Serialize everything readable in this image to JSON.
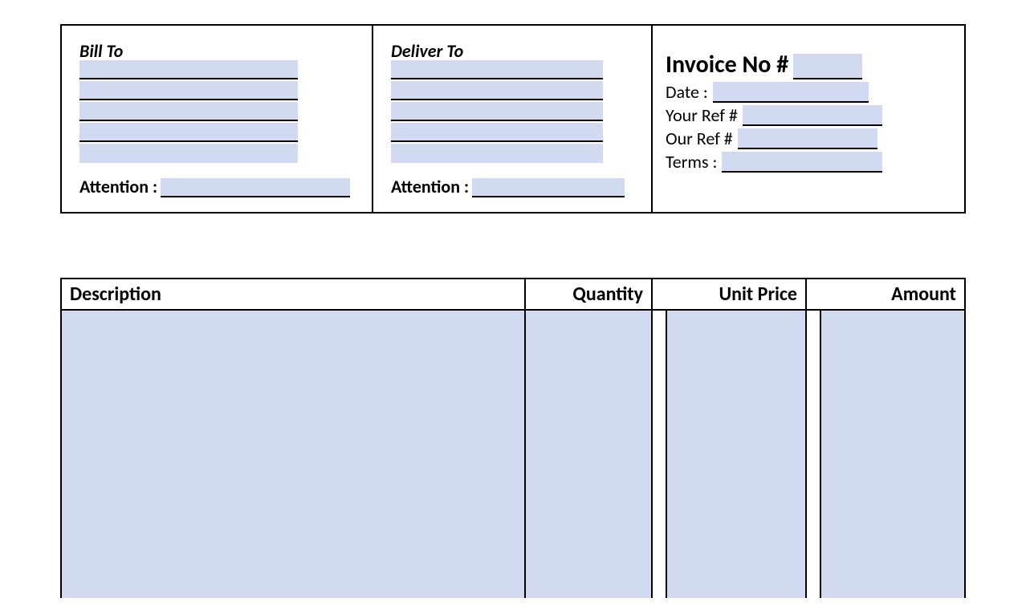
{
  "header": {
    "bill_to": {
      "title": "Bill To",
      "attention_label": "Attention :"
    },
    "deliver_to": {
      "title": "Deliver To",
      "attention_label": "Attention :"
    },
    "invoice": {
      "invoice_no_label": "Invoice No #",
      "date_label": "Date :",
      "your_ref_label": "Your Ref #",
      "our_ref_label": "Our Ref #",
      "terms_label": "Terms :"
    }
  },
  "line_items": {
    "headers": {
      "description": "Description",
      "quantity": "Quantity",
      "unit_price": "Unit Price",
      "amount": "Amount"
    }
  },
  "colors": {
    "fill": "#d1daf0",
    "border": "#000000"
  }
}
